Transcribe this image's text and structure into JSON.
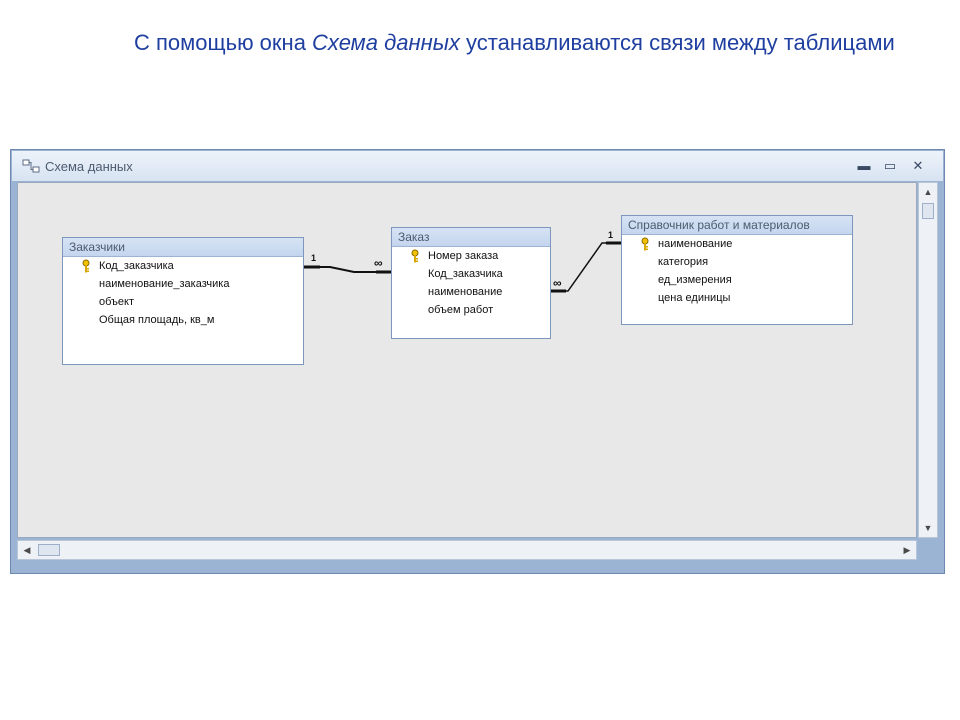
{
  "slide": {
    "title_part1": "С помощью окна ",
    "title_italic": "Схема данных",
    "title_part2": " устанавливаются связи между таблицами"
  },
  "window": {
    "title": "Схема данных",
    "controls": {
      "minimize": "▬",
      "maximize": "▭",
      "close": "✕"
    }
  },
  "tables": [
    {
      "title": "Заказчики",
      "fields": [
        {
          "name": "Код_заказчика",
          "key": true
        },
        {
          "name": "наименование_заказчика",
          "key": false
        },
        {
          "name": "объект",
          "key": false
        },
        {
          "name": "Общая площадь, кв_м",
          "key": false
        }
      ]
    },
    {
      "title": "Заказ",
      "fields": [
        {
          "name": "Номер заказа",
          "key": true
        },
        {
          "name": "Код_заказчика",
          "key": false
        },
        {
          "name": "наименование",
          "key": false
        },
        {
          "name": "объем работ",
          "key": false
        }
      ]
    },
    {
      "title": "Справочник работ и материалов",
      "fields": [
        {
          "name": "наименование",
          "key": true
        },
        {
          "name": "категория",
          "key": false
        },
        {
          "name": "ед_измерения",
          "key": false
        },
        {
          "name": "цена единицы",
          "key": false
        }
      ]
    }
  ],
  "relationships": [
    {
      "from_table": "Заказчики",
      "to_table": "Заказ",
      "one_label": "1",
      "many_label": "∞"
    },
    {
      "from_table": "Справочник работ и материалов",
      "to_table": "Заказ",
      "one_label": "1",
      "many_label": "∞"
    }
  ],
  "icons": {
    "window": "relationships-icon",
    "key": "primary-key-icon"
  }
}
